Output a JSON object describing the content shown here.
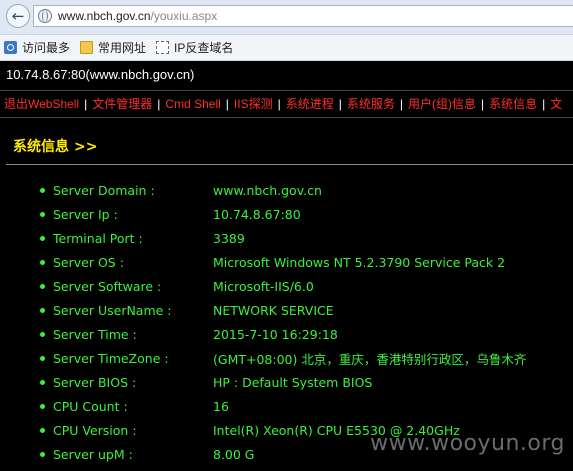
{
  "browser": {
    "url_host": "www.nbch.gov.cn",
    "url_path": "/youxiu.aspx",
    "favorites": [
      {
        "label": "访问最多",
        "icon": "most-visited-icon"
      },
      {
        "label": "常用网址",
        "icon": "folder-icon"
      },
      {
        "label": "IP反查域名",
        "icon": "page-icon"
      }
    ]
  },
  "server_line": "10.74.8.67:80(www.nbch.gov.cn)",
  "menu": [
    "退出WebShell",
    "文件管理器",
    "Cmd Shell",
    "IIS探测",
    "系统进程",
    "系统服务",
    "用户(组)信息",
    "系统信息",
    "文"
  ],
  "section": {
    "title": "系统信息",
    "arrows": ">>"
  },
  "info": [
    {
      "label": "Server Domain :",
      "value": "www.nbch.gov.cn"
    },
    {
      "label": "Server Ip :",
      "value": "10.74.8.67:80"
    },
    {
      "label": "Terminal Port :",
      "value": "3389"
    },
    {
      "label": "Server OS :",
      "value": "Microsoft Windows NT 5.2.3790 Service Pack 2"
    },
    {
      "label": "Server Software :",
      "value": "Microsoft-IIS/6.0"
    },
    {
      "label": "Server UserName :",
      "value": "NETWORK SERVICE"
    },
    {
      "label": "Server Time :",
      "value": "2015-7-10 16:29:18"
    },
    {
      "label": "Server TimeZone :",
      "value": "(GMT+08:00) 北京，重庆，香港特别行政区，乌鲁木齐"
    },
    {
      "label": "Server BIOS :",
      "value": "HP : Default System BIOS"
    },
    {
      "label": "CPU Count :",
      "value": "16"
    },
    {
      "label": "CPU Version :",
      "value": "Intel(R) Xeon(R) CPU E5530 @ 2.40GHz"
    },
    {
      "label": "Server upM :",
      "value": "8.00 G"
    }
  ],
  "watermark": "www.wooyun.org",
  "colors": {
    "menu_link": "#ff2d2d",
    "section_title": "#ffea00",
    "info_text": "#3cf03c",
    "background": "#000000"
  }
}
